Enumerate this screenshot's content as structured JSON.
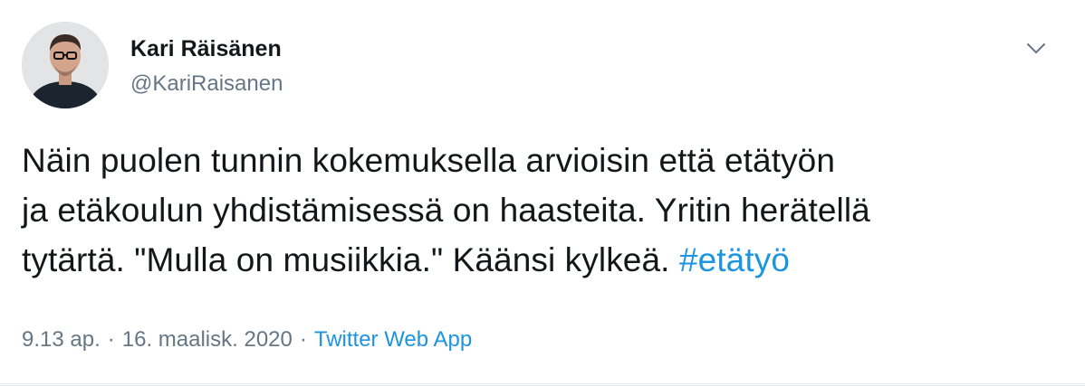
{
  "author": {
    "display_name": "Kari Räisänen",
    "handle": "@KariRaisanen"
  },
  "tweet": {
    "lines": [
      "Näin puolen tunnin kokemuksella arvioisin että etätyön",
      "ja etäkoulun yhdistämisessä on haasteita. Yritin herätellä",
      "tytärtä. \"Mulla on musiikkia.\" Käänsi kylkeä."
    ],
    "hashtag": "#etätyö"
  },
  "meta": {
    "time": "9.13 ap.",
    "separator": "·",
    "date": "16. maalisk. 2020",
    "source": "Twitter Web App"
  },
  "icons": {
    "more": "chevron-down-icon",
    "avatar": "profile-photo"
  },
  "colors": {
    "link": "#1b95e0",
    "secondary_text": "#657786",
    "primary_text": "#14171a"
  }
}
